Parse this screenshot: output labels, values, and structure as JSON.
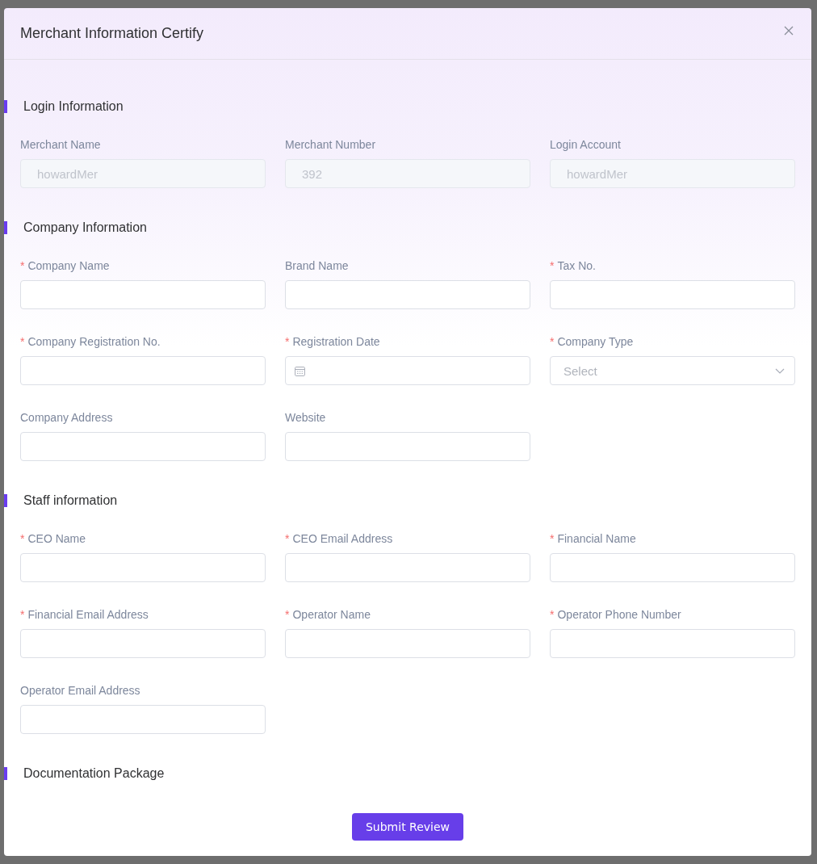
{
  "dialog": {
    "title": "Merchant Information Certify"
  },
  "sections": [
    {
      "title": "Login Information",
      "fields": [
        {
          "label": "Merchant Name",
          "kind": "text",
          "disabled": true,
          "value": "howardMer"
        },
        {
          "label": "Merchant Number",
          "kind": "text",
          "disabled": true,
          "value": "392"
        },
        {
          "label": "Login Account",
          "kind": "text",
          "disabled": true,
          "value": "howardMer"
        }
      ]
    },
    {
      "title": "Company Information",
      "fields": [
        {
          "label": "Company Name",
          "kind": "text",
          "mark": "*"
        },
        {
          "label": "Brand Name",
          "kind": "text"
        },
        {
          "label": "Tax No.",
          "kind": "text",
          "mark": "*"
        },
        {
          "label": "Company Registration No.",
          "kind": "text",
          "mark": "*"
        },
        {
          "label": "Registration Date",
          "kind": "date",
          "mark": "*"
        },
        {
          "label": "Company Type",
          "kind": "select",
          "mark": "*",
          "placeholder": "Select"
        },
        {
          "label": "Company Address",
          "kind": "text"
        },
        {
          "label": "Website",
          "kind": "text"
        }
      ]
    },
    {
      "title": "Staff information",
      "fields": [
        {
          "label": "CEO Name",
          "kind": "text",
          "mark": "*"
        },
        {
          "label": "CEO Email Address",
          "kind": "text",
          "mark": "*"
        },
        {
          "label": "Financial Name",
          "kind": "text",
          "mark": "*"
        },
        {
          "label": "Financial Email Address",
          "kind": "text",
          "mark": "*"
        },
        {
          "label": "Operator Name",
          "kind": "text",
          "mark": "*"
        },
        {
          "label": "Operator Phone Number",
          "kind": "text",
          "mark": "*"
        },
        {
          "label": "Operator Email Address",
          "kind": "text"
        }
      ]
    },
    {
      "title": "Documentation Package"
    }
  ],
  "submit": {
    "label": "Submit Review"
  }
}
